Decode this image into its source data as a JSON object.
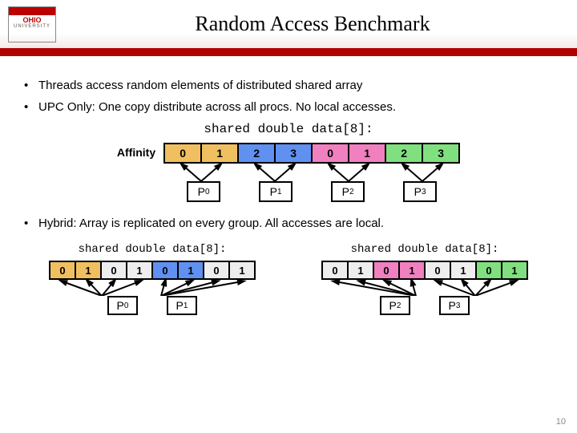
{
  "header": {
    "logo_text": "OHIO",
    "logo_sub": "UNIVERSITY",
    "title": "Random Access Benchmark"
  },
  "bullets": {
    "b1": "Threads access random elements of distributed shared array",
    "b2": "UPC Only: One copy distribute across all procs.  No local accesses.",
    "b3": "Hybrid: Array is replicated on every group.  All accesses are local."
  },
  "code": {
    "shared_decl": "shared double data[8]:"
  },
  "diagram1": {
    "affinity_label": "Affinity",
    "cells": [
      "0",
      "1",
      "2",
      "3",
      "0",
      "1",
      "2",
      "3"
    ],
    "procs": [
      "P0",
      "P1",
      "P2",
      "P3"
    ]
  },
  "diagram2": {
    "left": {
      "cells": [
        "0",
        "1",
        "0",
        "1",
        "0",
        "1",
        "0",
        "1"
      ],
      "procs": [
        "P0",
        "P1"
      ]
    },
    "right": {
      "cells": [
        "0",
        "1",
        "0",
        "1",
        "0",
        "1",
        "0",
        "1"
      ],
      "procs": [
        "P2",
        "P3"
      ]
    }
  },
  "page_number": "10"
}
